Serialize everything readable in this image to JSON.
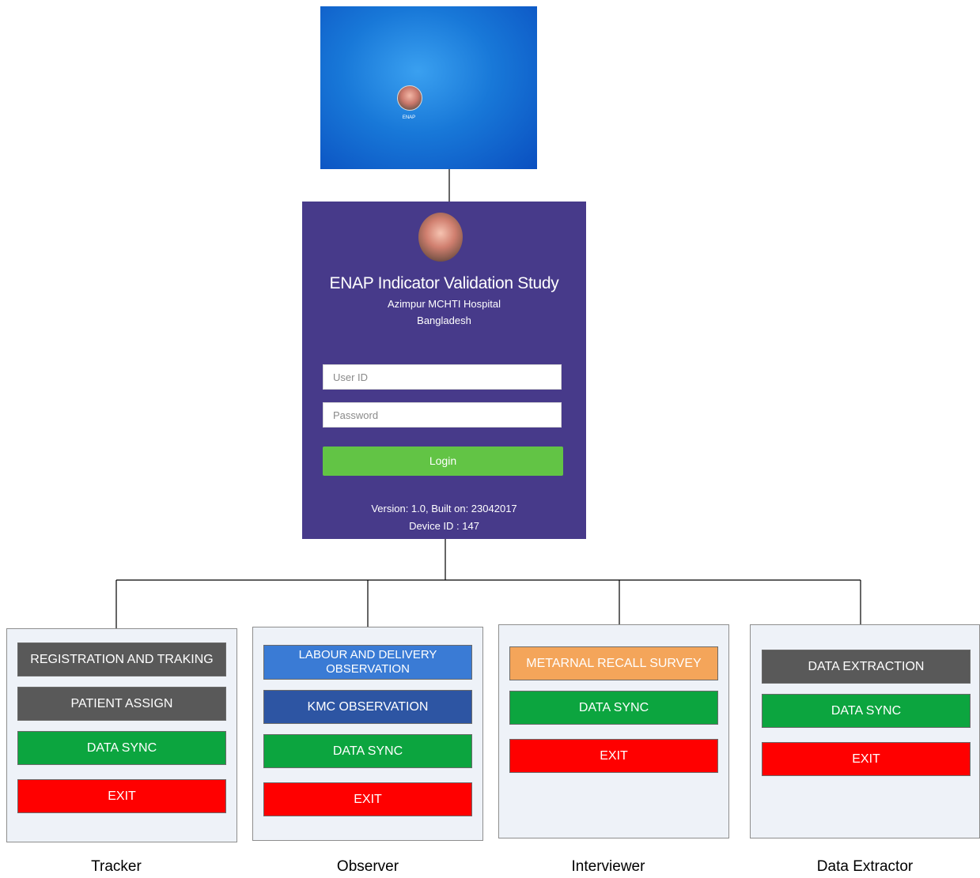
{
  "desktop": {
    "app_icon_label": "ENAP"
  },
  "login": {
    "title": "ENAP Indicator Validation Study",
    "hospital": "Azimpur MCHTI Hospital",
    "country": "Bangladesh",
    "user_id_placeholder": "User ID",
    "password_placeholder": "Password",
    "login_label": "Login",
    "version": "Version: 1.0, Built on: 23042017",
    "device_id": "Device ID : 147"
  },
  "roles": {
    "tracker": {
      "name": "Tracker",
      "buttons": [
        "REGISTRATION AND TRAKING",
        "PATIENT ASSIGN",
        "DATA SYNC",
        "EXIT"
      ]
    },
    "observer": {
      "name": "Observer",
      "buttons": [
        "LABOUR AND DELIVERY OBSERVATION",
        "KMC OBSERVATION",
        "DATA SYNC",
        "EXIT"
      ]
    },
    "interviewer": {
      "name": "Interviewer",
      "buttons": [
        "METARNAL RECALL SURVEY",
        "DATA SYNC",
        "EXIT"
      ]
    },
    "extractor": {
      "name": "Data Extractor",
      "buttons": [
        "DATA EXTRACTION",
        "DATA SYNC",
        "EXIT"
      ]
    }
  },
  "colors": {
    "login_bg": "#473a8a",
    "login_button": "#62c445",
    "gray_button": "#595959",
    "green_button": "#0ca53f",
    "red_button": "#ff0000",
    "blue_button": "#3a7bd5",
    "dark_blue_button": "#2d55a3",
    "orange_button": "#f4a55a"
  }
}
